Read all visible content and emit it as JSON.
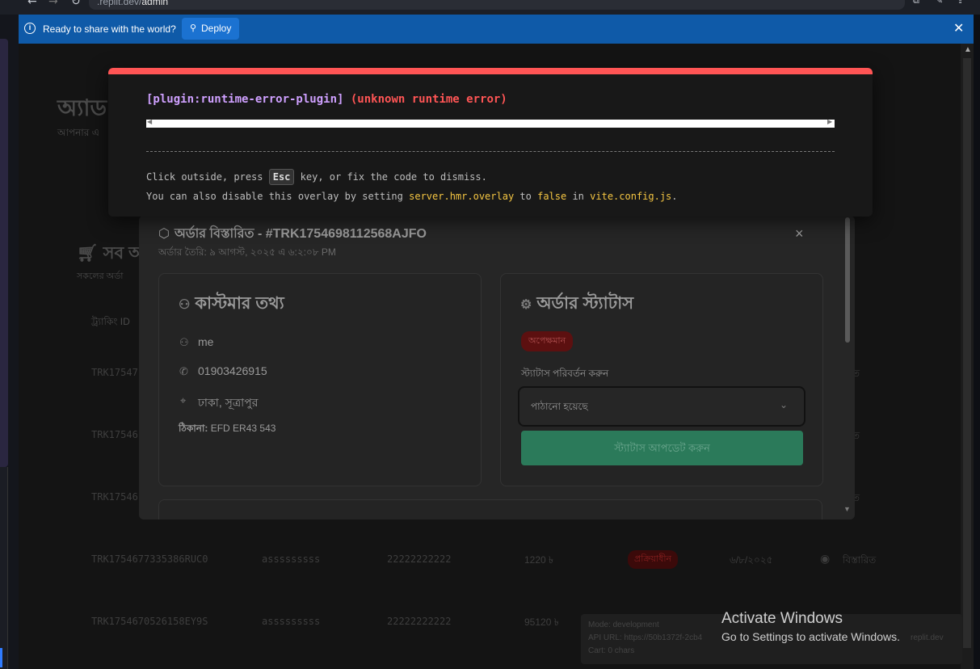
{
  "browser": {
    "url_host": "          .replit.dev/",
    "url_path": "admin"
  },
  "banner": {
    "message": "Ready to share with the world?",
    "deploy_label": "Deploy"
  },
  "background": {
    "page_title_partial": "অ্যাড",
    "page_subtitle_partial": "আপনার এ",
    "section_title_partial": "সব অ",
    "section_sub_partial": "সকলের অর্ডা",
    "col_tracking_partial": "ট্র্যাকিং ID",
    "rows": [
      {
        "id": "TRK17547",
        "name": "",
        "phone": "",
        "amount": "",
        "status": "",
        "date": "",
        "action": "রিত"
      },
      {
        "id": "TRK17546",
        "name": "",
        "phone": "",
        "amount": "",
        "status": "",
        "date": "",
        "action": "রিত"
      },
      {
        "id": "TRK17546",
        "name": "",
        "phone": "",
        "amount": "",
        "status": "",
        "date": "",
        "action": "রিত"
      },
      {
        "id": "TRK1754677335386RUC0",
        "name": "asssssssss",
        "phone": "22222222222",
        "amount": "1220 ৳",
        "status": "প্রক্রিয়াধীন",
        "date": "৬/৮/২০২৫",
        "action": "বিস্তারিত"
      },
      {
        "id": "TRK1754670526158EY9S",
        "name": "asssssssss",
        "phone": "22222222222",
        "amount": "95120 ৳",
        "status": "",
        "date": "",
        "action": ""
      }
    ]
  },
  "modal": {
    "title": "অর্ডার বিস্তারিত - #TRK1754698112568AJFO",
    "subtitle": "অর্ডার তৈরি: ৯ আগস্ট, ২০২৫ এ ৬:২:০৮ PM",
    "close_label": "×",
    "customer": {
      "heading": "কাস্টমার তথ্য",
      "name": "me",
      "phone": "01903426915",
      "location": "ঢাকা, সূত্রাপুর",
      "address_label": "ঠিকানা:",
      "address_value": "EFD ER43 543"
    },
    "status": {
      "heading": "অর্ডার স্ট্যাটাস",
      "badge": "অপেক্ষমান",
      "change_label": "স্ট্যাটাস পরিবর্তন করুন",
      "selected": "পাঠানো হয়েছে",
      "update_button": "স্ট্যাটাস আপডেট করুন"
    }
  },
  "overlay": {
    "plugin": "[plugin:runtime-error-plugin]",
    "error": "(unknown runtime error)",
    "tip1_pre": "Click outside, press",
    "tip1_key": "Esc",
    "tip1_post": "key, or fix the code to dismiss.",
    "tip2_pre": "You can also disable this overlay by setting",
    "tip2_code1": "server.hmr.overlay",
    "tip2_mid": "to",
    "tip2_code2": "false",
    "tip2_in": "in",
    "tip2_code3": "vite.config.js",
    "tip2_end": "."
  },
  "devpanel": {
    "mode": "Mode: development",
    "api": "API URL: https://50b1372f-2cb4",
    "cart": "Cart: 0 chars",
    "api_tail": "replit.dev"
  },
  "watermark": {
    "line1": "Activate Windows",
    "line2": "Go to Settings to activate Windows."
  }
}
